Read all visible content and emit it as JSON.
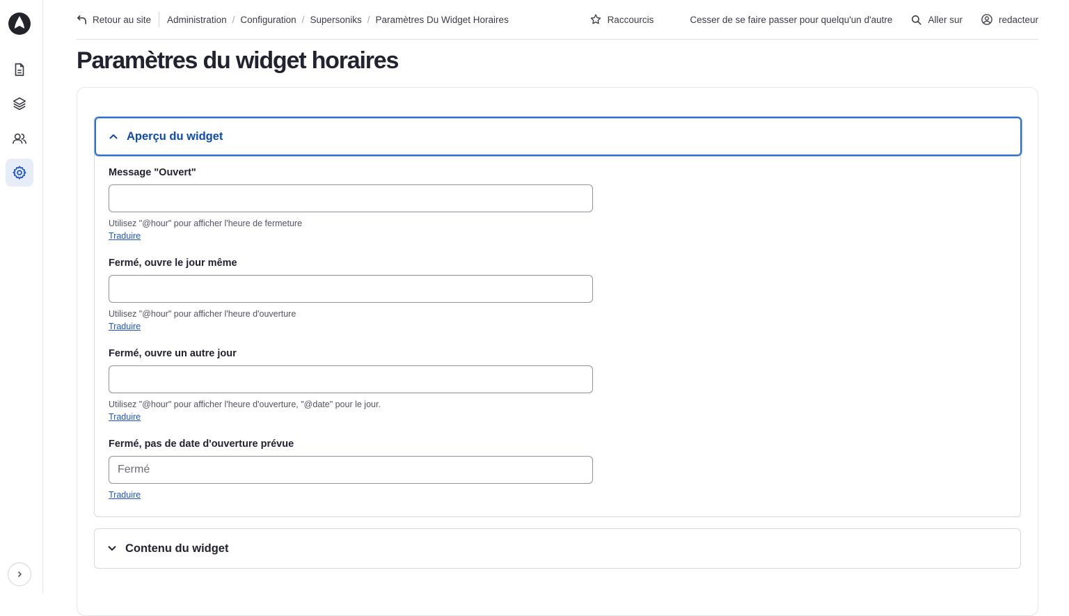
{
  "topbar": {
    "back_label": "Retour au site",
    "breadcrumbs": [
      "Administration",
      "Configuration",
      "Supersoniks",
      "Paramètres Du Widget Horaires"
    ],
    "shortcuts_label": "Raccourcis",
    "stop_impersonate_label": "Cesser de se faire passer pour quelqu'un d'autre",
    "goto_label": "Aller sur",
    "user_label": "redacteur"
  },
  "page": {
    "title": "Paramètres du widget horaires"
  },
  "sections": {
    "preview": {
      "label": "Aperçu du widget",
      "fields": [
        {
          "label": "Message \"Ouvert\"",
          "value": "",
          "placeholder": "",
          "description": "Utilisez \"@hour\" pour afficher l'heure de fermeture",
          "translate": "Traduire"
        },
        {
          "label": "Fermé, ouvre le jour même",
          "value": "",
          "placeholder": "",
          "description": "Utilisez \"@hour\" pour afficher l'heure d'ouverture",
          "translate": "Traduire"
        },
        {
          "label": "Fermé, ouvre un autre jour",
          "value": "",
          "placeholder": "",
          "description": "Utilisez \"@hour\" pour afficher l'heure d'ouverture, \"@date\" pour le jour.",
          "translate": "Traduire"
        },
        {
          "label": "Fermé, pas de date d'ouverture prévue",
          "value": "",
          "placeholder": "Fermé",
          "translate": "Traduire"
        }
      ]
    },
    "content": {
      "label": "Contenu du widget"
    }
  },
  "colors": {
    "accent": "#2f6fcf",
    "accent_text": "#0f4bb0",
    "active_nav_bg": "#e6ecf8"
  },
  "icons": [
    "logo-icon",
    "document-icon",
    "layers-icon",
    "users-icon",
    "gear-icon",
    "chevron-right-icon",
    "back-arrow-icon",
    "star-icon",
    "search-icon",
    "user-circle-icon",
    "chevron-up-icon",
    "chevron-down-icon"
  ]
}
